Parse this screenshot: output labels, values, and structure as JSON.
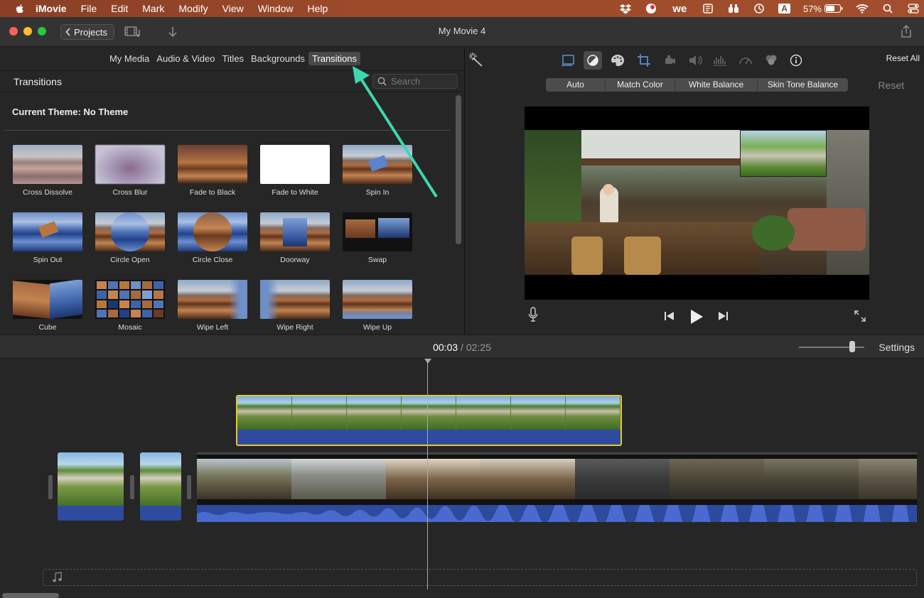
{
  "menubar": {
    "items": [
      "iMovie",
      "File",
      "Edit",
      "Mark",
      "Modify",
      "View",
      "Window",
      "Help"
    ],
    "battery": "57%",
    "keyboard": "A"
  },
  "toolbar": {
    "projects_label": "Projects",
    "title": "My Movie 4"
  },
  "browser": {
    "tabs": [
      "My Media",
      "Audio & Video",
      "Titles",
      "Backgrounds",
      "Transitions"
    ],
    "active_tab": "Transitions",
    "section_title": "Transitions",
    "search_placeholder": "Search",
    "theme_label": "Current Theme: No Theme",
    "transitions": [
      "Cross Dissolve",
      "Cross Blur",
      "Fade to Black",
      "Fade to White",
      "Spin In",
      "Spin Out",
      "Circle Open",
      "Circle Close",
      "Doorway",
      "Swap",
      "Cube",
      "Mosaic",
      "Wipe Left",
      "Wipe Right",
      "Wipe Up"
    ]
  },
  "viewer": {
    "reset_all": "Reset All",
    "color_buttons": [
      "Auto",
      "Match Color",
      "White Balance",
      "Skin Tone Balance"
    ],
    "reset": "Reset"
  },
  "timeline": {
    "current_time": "00:03",
    "separator": "/",
    "duration": "02:25",
    "settings_label": "Settings"
  },
  "colors": {
    "accent_arrow": "#3ed6ae",
    "selection": "#e6c72e",
    "audio": "#2f4ba0"
  }
}
